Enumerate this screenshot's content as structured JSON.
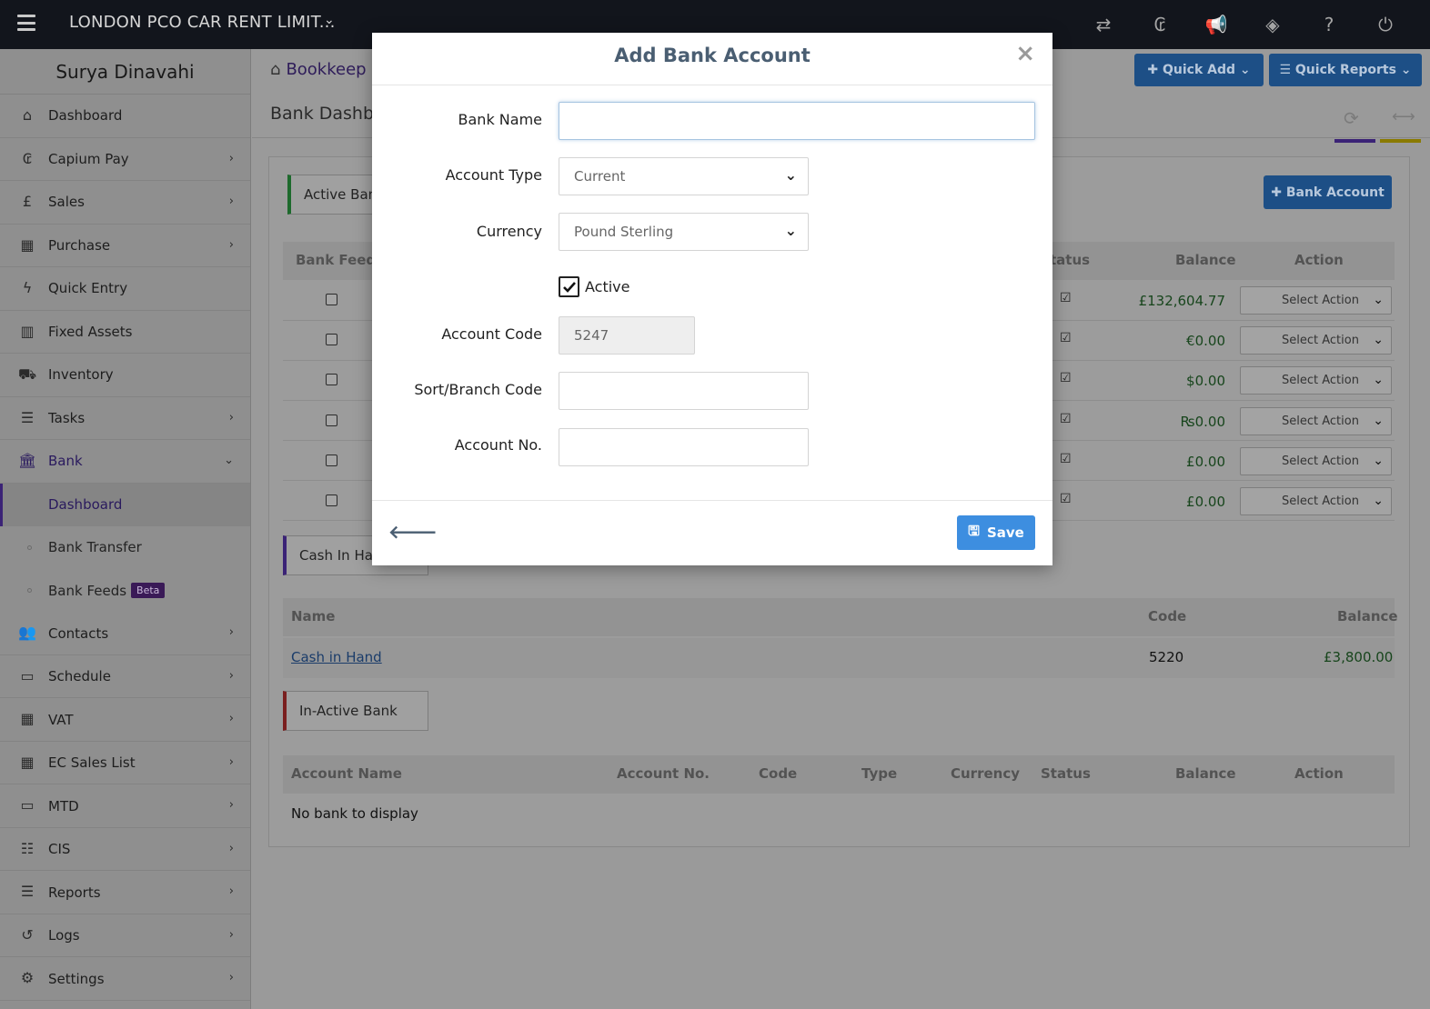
{
  "topbar": {
    "company": "LONDON PCO CAR RENT LIMIT...",
    "icons": [
      "transfer-icon",
      "capium-icon",
      "megaphone-icon",
      "ticket-icon",
      "help-icon",
      "power-icon"
    ]
  },
  "sidebar": {
    "user": "Surya Dinavahi",
    "items": [
      {
        "label": "Dashboard",
        "icon": "home-icon"
      },
      {
        "label": "Capium Pay",
        "icon": "capium-pay-icon"
      },
      {
        "label": "Sales",
        "icon": "pound-icon"
      },
      {
        "label": "Purchase",
        "icon": "qrcode-icon"
      },
      {
        "label": "Quick Entry",
        "icon": "bolt-icon"
      },
      {
        "label": "Fixed Assets",
        "icon": "building-icon"
      },
      {
        "label": "Inventory",
        "icon": "truck-icon"
      },
      {
        "label": "Tasks",
        "icon": "tasks-icon"
      },
      {
        "label": "Bank",
        "icon": "bank-icon"
      }
    ],
    "bank_sub": [
      {
        "label": "Dashboard"
      },
      {
        "label": "Bank Transfer"
      },
      {
        "label": "Bank Feeds",
        "badge": "Beta"
      }
    ],
    "items2": [
      {
        "label": "Contacts",
        "icon": "users-icon"
      },
      {
        "label": "Schedule",
        "icon": "calendar-icon"
      },
      {
        "label": "VAT",
        "icon": "calculator-icon"
      },
      {
        "label": "EC Sales List",
        "icon": "calculator-icon"
      },
      {
        "label": "MTD",
        "icon": "calendar-icon"
      },
      {
        "label": "CIS",
        "icon": "list-icon"
      },
      {
        "label": "Reports",
        "icon": "list-icon"
      },
      {
        "label": "Logs",
        "icon": "history-icon"
      },
      {
        "label": "Settings",
        "icon": "gears-icon"
      }
    ]
  },
  "header": {
    "breadcrumb": "Bookkeep",
    "quick_add": "Quick Add",
    "quick_reports": "Quick Reports",
    "page_title": "Bank Dashbo"
  },
  "active_bank": {
    "tag": "Active Bank",
    "add_button": "Bank Account",
    "columns": {
      "bank_feeds": "Bank Feeds",
      "status": "tatus",
      "balance": "Balance",
      "action": "Action"
    },
    "rows": [
      {
        "balance": "£132,604.77",
        "action": "Select Action"
      },
      {
        "balance": "€0.00",
        "action": "Select Action"
      },
      {
        "balance": "$0.00",
        "action": "Select Action"
      },
      {
        "balance": "₨0.00",
        "action": "Select Action"
      },
      {
        "balance": "£0.00",
        "action": "Select Action"
      },
      {
        "balance": "£0.00",
        "action": "Select Action"
      }
    ]
  },
  "cash_in_hand": {
    "tag": "Cash In Hand",
    "columns": {
      "name": "Name",
      "code": "Code",
      "balance": "Balance"
    },
    "row": {
      "name": "Cash in Hand",
      "code": "5220",
      "balance": "£3,800.00"
    }
  },
  "inactive_bank": {
    "tag": "In-Active Bank",
    "columns": {
      "account_name": "Account Name",
      "account_no": "Account No.",
      "code": "Code",
      "type": "Type",
      "currency": "Currency",
      "status": "Status",
      "balance": "Balance",
      "action": "Action"
    },
    "empty": "No bank to display"
  },
  "modal": {
    "title": "Add Bank Account",
    "close": "×",
    "bank_name_label": "Bank Name",
    "bank_name_value": "",
    "account_type_label": "Account Type",
    "account_type_value": "Current",
    "currency_label": "Currency",
    "currency_value": "Pound Sterling",
    "active_label": "Active",
    "active_checked": true,
    "account_code_label": "Account Code",
    "account_code_value": "5247",
    "sort_code_label": "Sort/Branch Code",
    "sort_code_value": "",
    "account_no_label": "Account No.",
    "account_no_value": "",
    "save_label": "Save"
  }
}
